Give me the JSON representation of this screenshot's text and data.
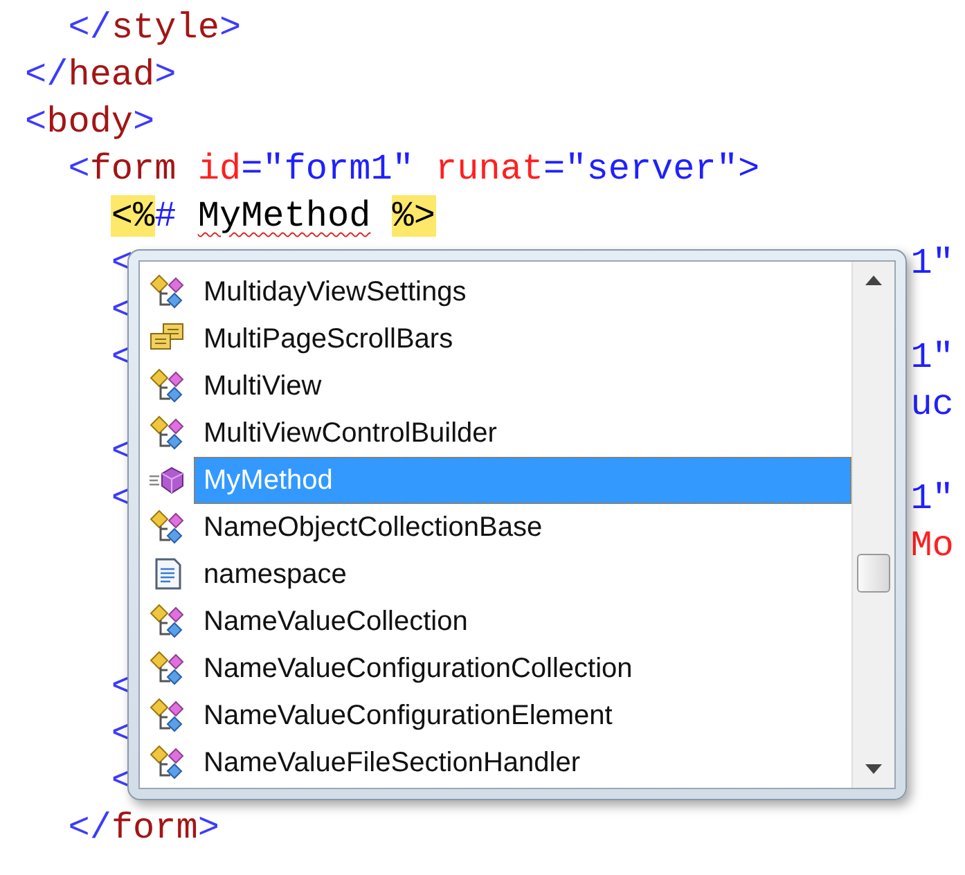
{
  "code_lines": [
    {
      "tokens": [
        {
          "text": "  </",
          "kind": "delim"
        },
        {
          "text": "style",
          "kind": "tag"
        },
        {
          "text": ">",
          "kind": "delim"
        }
      ]
    },
    {
      "tokens": [
        {
          "text": "</",
          "kind": "delim"
        },
        {
          "text": "head",
          "kind": "tag"
        },
        {
          "text": ">",
          "kind": "delim"
        }
      ]
    },
    {
      "tokens": [
        {
          "text": "<",
          "kind": "delim"
        },
        {
          "text": "body",
          "kind": "tag"
        },
        {
          "text": ">",
          "kind": "delim"
        }
      ]
    },
    {
      "tokens": [
        {
          "text": "  <",
          "kind": "delim"
        },
        {
          "text": "form",
          "kind": "tag"
        },
        {
          "text": " id",
          "kind": "attr"
        },
        {
          "text": "=\"form1\"",
          "kind": "value"
        },
        {
          "text": " runat",
          "kind": "attr"
        },
        {
          "text": "=\"server\">",
          "kind": "value"
        }
      ]
    },
    {
      "tokens": [
        {
          "text": "    <%",
          "kind": "asp"
        },
        {
          "text": "#",
          "kind": "value"
        },
        {
          "text": " MyMethod",
          "kind": "error"
        },
        {
          "text": " %>",
          "kind": "asp"
        }
      ]
    },
    {
      "tokens": [
        {
          "text": "    <",
          "kind": "delim"
        }
      ],
      "right": [
        {
          "text": "1\"",
          "kind": "value"
        }
      ]
    },
    {
      "tokens": [
        {
          "text": "    <",
          "kind": "delim"
        }
      ]
    },
    {
      "tokens": [
        {
          "text": "    <",
          "kind": "delim"
        }
      ],
      "right": [
        {
          "text": "1\"",
          "kind": "value"
        }
      ]
    },
    {
      "right": [
        {
          "text": "uc",
          "kind": "value"
        }
      ]
    },
    {
      "tokens": [
        {
          "text": "    <",
          "kind": "delim"
        }
      ]
    },
    {
      "tokens": [
        {
          "text": "    <",
          "kind": "delim"
        }
      ],
      "right": [
        {
          "text": "1\"",
          "kind": "value"
        }
      ]
    },
    {
      "right": [
        {
          "text": "Mo",
          "kind": "attr"
        }
      ]
    }
  ],
  "code_lines_below": [
    {
      "tokens": [
        {
          "text": "    <",
          "kind": "delim"
        }
      ]
    },
    {
      "tokens": [
        {
          "text": "    <",
          "kind": "delim"
        }
      ]
    },
    {
      "tokens": [
        {
          "text": "    <",
          "kind": "delim"
        }
      ]
    },
    {
      "tokens": [
        {
          "text": "  </",
          "kind": "delim"
        },
        {
          "text": "form",
          "kind": "tag"
        },
        {
          "text": ">",
          "kind": "delim"
        }
      ]
    }
  ],
  "completion_list": {
    "items": [
      {
        "label": "MultidayViewSettings",
        "kind": "class",
        "selected": false
      },
      {
        "label": "MultiPageScrollBars",
        "kind": "struct",
        "selected": false
      },
      {
        "label": "MultiView",
        "kind": "class",
        "selected": false
      },
      {
        "label": "MultiViewControlBuilder",
        "kind": "class",
        "selected": false
      },
      {
        "label": "MyMethod",
        "kind": "method",
        "selected": true
      },
      {
        "label": "NameObjectCollectionBase",
        "kind": "class",
        "selected": false
      },
      {
        "label": "namespace",
        "kind": "snippet",
        "selected": false
      },
      {
        "label": "NameValueCollection",
        "kind": "class",
        "selected": false
      },
      {
        "label": "NameValueConfigurationCollection",
        "kind": "class",
        "selected": false
      },
      {
        "label": "NameValueConfigurationElement",
        "kind": "class",
        "selected": false
      },
      {
        "label": "NameValueFileSectionHandler",
        "kind": "class",
        "selected": false
      }
    ]
  }
}
